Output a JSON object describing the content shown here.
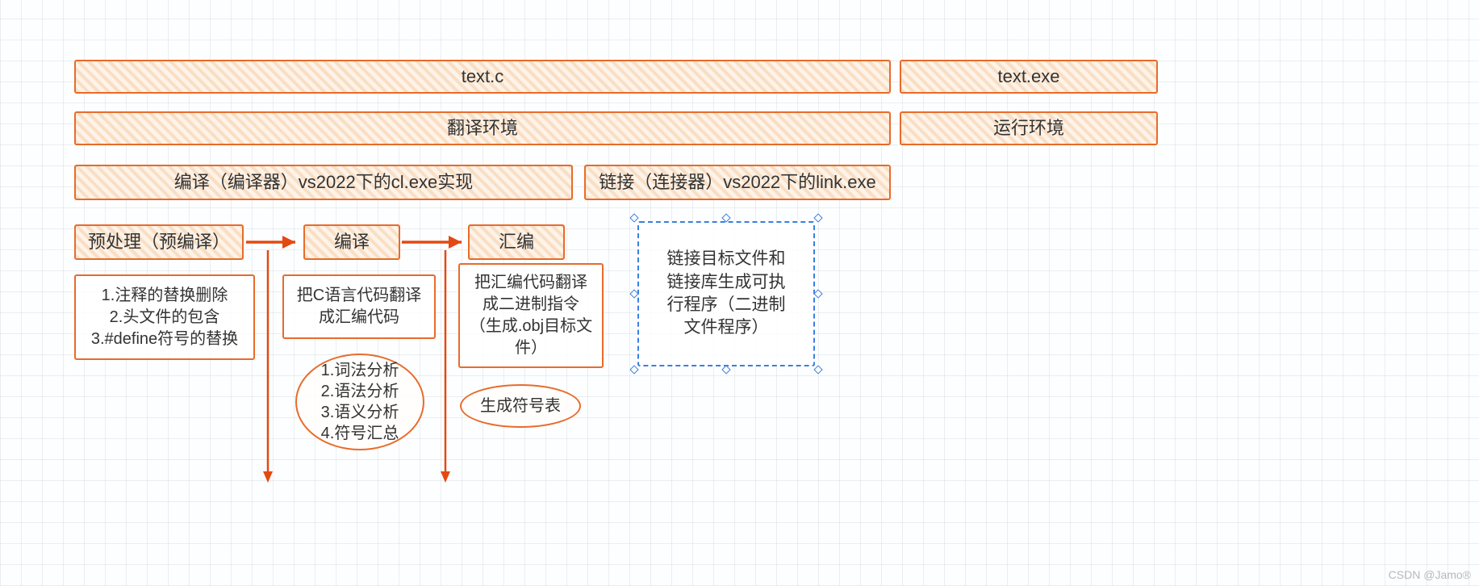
{
  "row1": {
    "source_file": "text.c",
    "executable": "text.exe"
  },
  "row2": {
    "translate_env": "翻译环境",
    "runtime_env": "运行环境"
  },
  "row3": {
    "compiler": "编译（编译器）vs2022下的cl.exe实现",
    "linker": "链接（连接器）vs2022下的link.exe"
  },
  "stages": {
    "preprocess": {
      "title": "预处理（预编译）",
      "detail": "1.注释的替换删除\n2.头文件的包含\n3.#define符号的替换"
    },
    "compile": {
      "title": "编译",
      "detail": "把C语言代码翻译\n成汇编代码",
      "analysis": "1.词法分析\n2.语法分析\n3.语义分析\n4.符号汇总"
    },
    "assemble": {
      "title": "汇编",
      "detail": "把汇编代码翻译\n成二进制指令\n（生成.obj目标文\n件）",
      "symbol_table": "生成符号表"
    },
    "link": {
      "detail": "链接目标文件和\n链接库生成可执\n行程序（二进制\n文件程序）"
    }
  },
  "watermark": "CSDN @Jamo®"
}
